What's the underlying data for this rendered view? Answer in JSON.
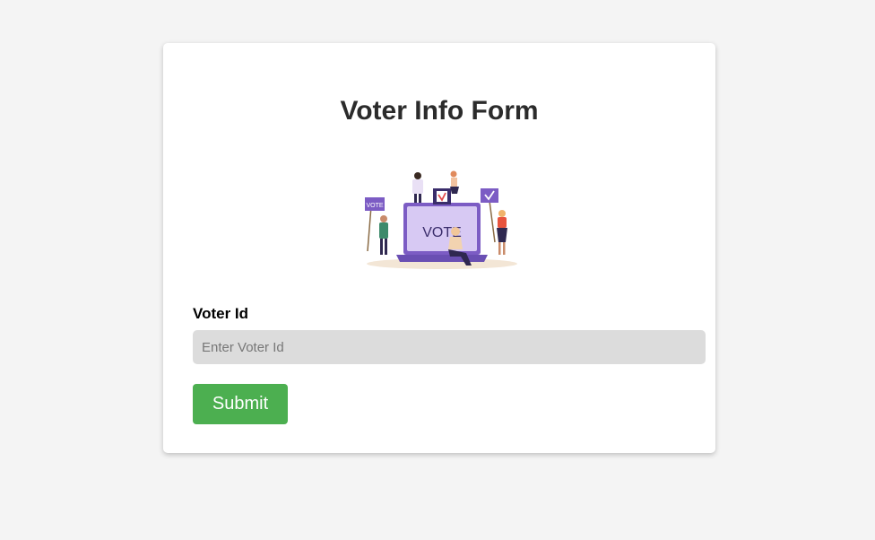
{
  "form": {
    "title": "Voter Info Form",
    "illustration_icon": "vote-illustration",
    "illustration_text": "VOTE",
    "voter_id": {
      "label": "Voter Id",
      "placeholder": "Enter Voter Id",
      "value": ""
    },
    "submit_label": "Submit"
  },
  "colors": {
    "page_background": "#f4f4f4",
    "card_background": "#ffffff",
    "input_background": "#dcdcdc",
    "submit_button": "#4caf50",
    "laptop_purple": "#7c5cc4"
  }
}
